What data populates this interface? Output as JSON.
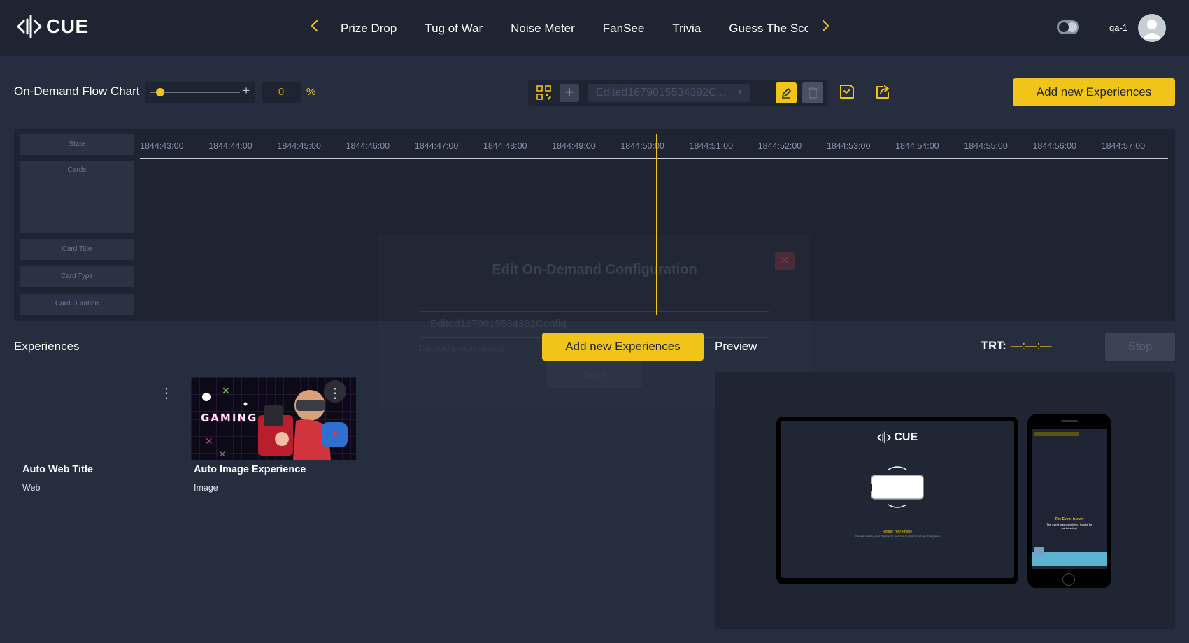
{
  "header": {
    "logo_text": "CUE",
    "tabs": [
      "Prize Drop",
      "Tug of War",
      "Noise Meter",
      "FanSee",
      "Trivia",
      "Guess The Score"
    ],
    "username": "qa-1"
  },
  "toolbar": {
    "title": "On-Demand Flow Chart",
    "zoom_minus": "–",
    "zoom_plus": "+",
    "zoom_level_fraction": 0,
    "zoom_value": "0",
    "zoom_unit": "%",
    "config_name": "Edited1679015534392C...",
    "add_button": "Add new Experiences"
  },
  "timeline": {
    "row_labels": [
      "State",
      "Cards",
      "Card Title",
      "Card Type",
      "Card Duration"
    ],
    "ticks": [
      "1844:43:00",
      "1844:44:00",
      "1844:45:00",
      "1844:46:00",
      "1844:47:00",
      "1844:48:00",
      "1844:49:00",
      "1844:50:00",
      "1844:51:00",
      "1844:52:00",
      "1844:53:00",
      "1844:54:00",
      "1844:55:00",
      "1844:56:00",
      "1844:57:00"
    ]
  },
  "modal": {
    "title": "Edit On-Demand Configuration",
    "input_value": "Edited1679015534392Config",
    "hint": "This config name already",
    "button": "Save"
  },
  "experiences": {
    "title": "Experiences",
    "add_button": "Add new Experiences",
    "items": [
      {
        "name": "Auto Web Title",
        "type": "Web"
      },
      {
        "name": "Auto Image Experience",
        "type": "Image"
      }
    ]
  },
  "preview": {
    "title": "Preview",
    "trt_label": "TRT:",
    "trt_value": "—:—:—",
    "stop_button": "Stop",
    "tablet_logo": "CUE",
    "tablet_heading": "Rotate Your Phone",
    "tablet_text": "Please rotate your device to portrait mode for using this game",
    "phone_heading": "The Event is over",
    "phone_text": "The event was completed, thanks for participating!"
  },
  "colors": {
    "accent": "#f0c419",
    "background": "#262d3f",
    "panel": "#1e2431"
  }
}
